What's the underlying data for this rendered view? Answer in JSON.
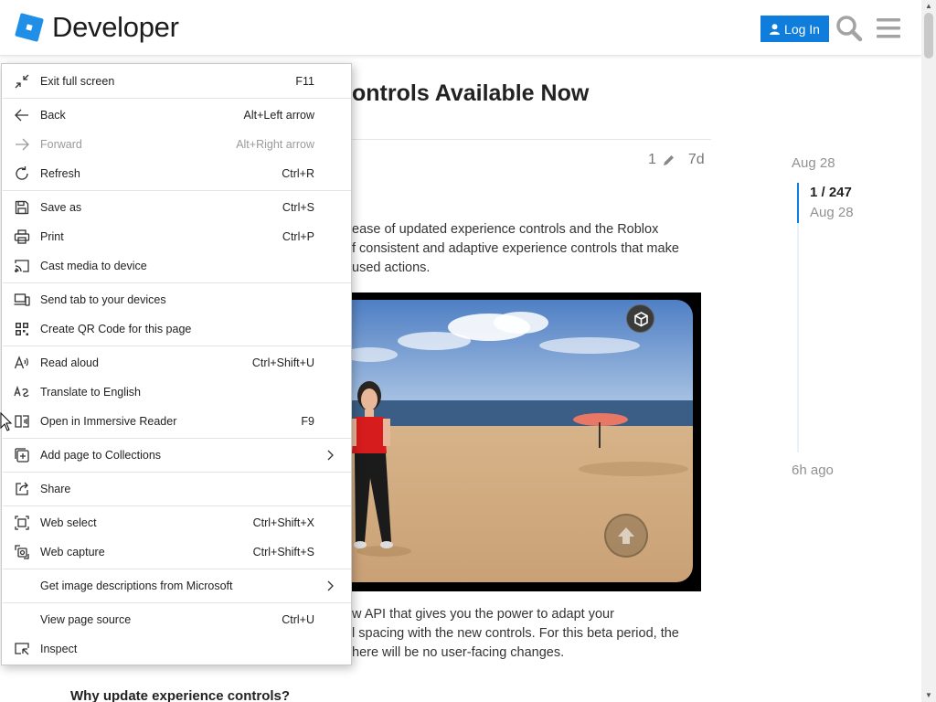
{
  "header": {
    "logo_text": "Developer",
    "login_label": "Log In",
    "colors": {
      "accent": "#0e7ddc",
      "logo": "#1f8fe8"
    }
  },
  "topic": {
    "title": "ontrols Available Now",
    "edits": "1",
    "age": "7d",
    "paragraph_1": [
      "ease of updated experience controls and the Roblox",
      "f consistent and adaptive experience controls that make",
      " used actions."
    ],
    "paragraph_2": [
      "w API that gives you the power to adapt your",
      "l spacing with the new controls. For this beta period, the",
      "here will be no user-facing changes."
    ],
    "section_heading": "Why update experience controls?"
  },
  "timeline": {
    "top_date": "Aug 28",
    "count": "1 / 247",
    "current_date": "Aug 28",
    "bottom_date": "6h ago"
  },
  "context_menu": {
    "items": [
      {
        "label": "Exit full screen",
        "shortcut": "F11",
        "icon": "exit-fullscreen-icon"
      },
      {
        "label": "Back",
        "shortcut": "Alt+Left arrow",
        "icon": "back-arrow-icon"
      },
      {
        "label": "Forward",
        "shortcut": "Alt+Right arrow",
        "icon": "forward-arrow-icon",
        "disabled": true
      },
      {
        "label": "Refresh",
        "shortcut": "Ctrl+R",
        "icon": "refresh-icon"
      },
      {
        "label": "Save as",
        "shortcut": "Ctrl+S",
        "icon": "save-icon"
      },
      {
        "label": "Print",
        "shortcut": "Ctrl+P",
        "icon": "print-icon"
      },
      {
        "label": "Cast media to device",
        "shortcut": "",
        "icon": "cast-icon"
      },
      {
        "label": "Send tab to your devices",
        "shortcut": "",
        "icon": "devices-icon"
      },
      {
        "label": "Create QR Code for this page",
        "shortcut": "",
        "icon": "qr-code-icon"
      },
      {
        "label": "Read aloud",
        "shortcut": "Ctrl+Shift+U",
        "icon": "read-aloud-icon"
      },
      {
        "label": "Translate to English",
        "shortcut": "",
        "icon": "translate-icon"
      },
      {
        "label": "Open in Immersive Reader",
        "shortcut": "F9",
        "icon": "immersive-reader-icon"
      },
      {
        "label": "Add page to Collections",
        "shortcut": "",
        "icon": "collections-icon",
        "submenu": true
      },
      {
        "label": "Share",
        "shortcut": "",
        "icon": "share-icon"
      },
      {
        "label": "Web select",
        "shortcut": "Ctrl+Shift+X",
        "icon": "web-select-icon"
      },
      {
        "label": "Web capture",
        "shortcut": "Ctrl+Shift+S",
        "icon": "web-capture-icon"
      },
      {
        "label": "Get image descriptions from Microsoft",
        "shortcut": "",
        "icon": "",
        "submenu": true
      },
      {
        "label": "View page source",
        "shortcut": "Ctrl+U",
        "icon": ""
      },
      {
        "label": "Inspect",
        "shortcut": "",
        "icon": "inspect-icon"
      }
    ]
  }
}
